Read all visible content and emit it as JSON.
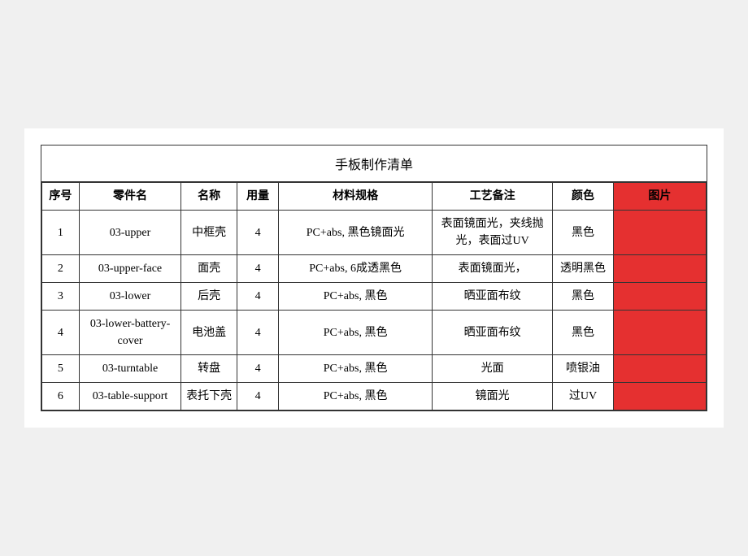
{
  "title": "手板制作清单",
  "headers": {
    "seq": "序号",
    "part_code": "零件名",
    "name": "名称",
    "quantity": "用量",
    "spec": "材料规格",
    "process": "工艺备注",
    "color": "颜色",
    "image": "图片"
  },
  "rows": [
    {
      "seq": "1",
      "part_code": "03-upper",
      "name": "中框壳",
      "quantity": "4",
      "spec": "PC+abs, 黑色镜面光",
      "process": "表面镜面光，夹线抛光，表面过UV",
      "color": "黑色"
    },
    {
      "seq": "2",
      "part_code": "03-upper-face",
      "name": "面壳",
      "quantity": "4",
      "spec": "PC+abs, 6成透黑色",
      "process": "表面镜面光，",
      "color": "透明黑色"
    },
    {
      "seq": "3",
      "part_code": "03-lower",
      "name": "后壳",
      "quantity": "4",
      "spec": "PC+abs, 黑色",
      "process": "晒亚面布纹",
      "color": "黑色"
    },
    {
      "seq": "4",
      "part_code": "03-lower-battery-cover",
      "name": "电池盖",
      "quantity": "4",
      "spec": "PC+abs, 黑色",
      "process": "晒亚面布纹",
      "color": "黑色"
    },
    {
      "seq": "5",
      "part_code": "03-turntable",
      "name": "转盘",
      "quantity": "4",
      "spec": "PC+abs, 黑色",
      "process": "光面",
      "color": "喷银油"
    },
    {
      "seq": "6",
      "part_code": "03-table-support",
      "name": "表托下壳",
      "quantity": "4",
      "spec": "PC+abs, 黑色",
      "process": "镜面光",
      "color": "过UV"
    }
  ]
}
